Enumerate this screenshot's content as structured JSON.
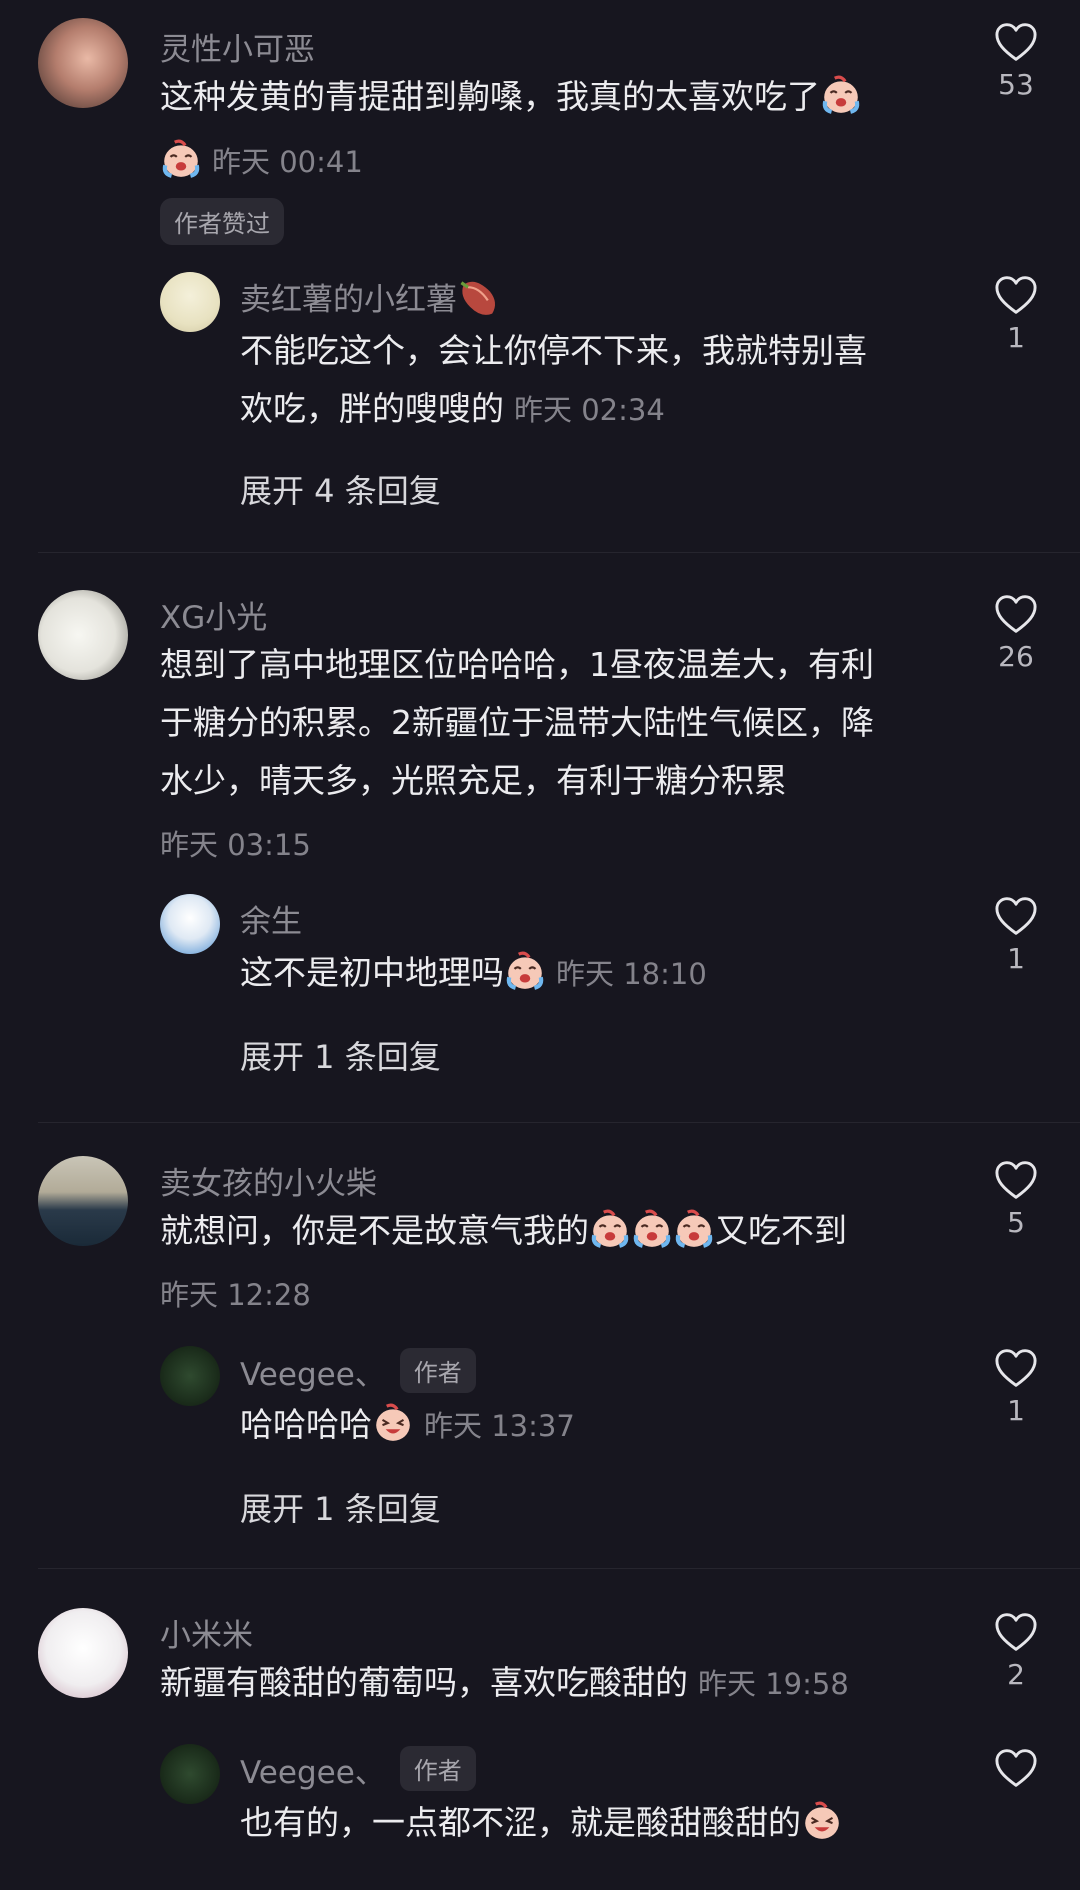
{
  "comments": [
    {
      "username": "灵性小可恶",
      "text_lines": [
        "这种发黄的青提甜到齁嗓，我真的太喜欢吃了"
      ],
      "time": "昨天 00:41",
      "likes": "53",
      "badge": "作者赞过",
      "reply": {
        "username": "卖红薯的小红薯",
        "text_lines": [
          "不能吃这个，会让你停不下来，我就特别喜",
          "欢吃，胖的嗖嗖的"
        ],
        "time": "昨天 02:34",
        "likes": "1"
      },
      "expand": "展开 4 条回复"
    },
    {
      "username": "XG小光",
      "text_lines": [
        "想到了高中地理区位哈哈哈，1昼夜温差大，有利",
        "于糖分的积累。2新疆位于温带大陆性气候区，降",
        "水少，晴天多，光照充足，有利于糖分积累"
      ],
      "time": "昨天 03:15",
      "likes": "26",
      "reply": {
        "username": "余生",
        "text_lines": [
          "这不是初中地理吗"
        ],
        "time": "昨天 18:10",
        "likes": "1"
      },
      "expand": "展开 1 条回复"
    },
    {
      "username": "卖女孩的小火柴",
      "text_lines": [
        "就想问，你是不是故意气我的",
        "又吃不到"
      ],
      "time": "昨天 12:28",
      "likes": "5",
      "reply": {
        "username": "Veegee、",
        "author_badge": "作者",
        "text_lines": [
          "哈哈哈哈"
        ],
        "time": "昨天 13:37",
        "likes": "1"
      },
      "expand": "展开 1 条回复"
    },
    {
      "username": "小米米",
      "text_lines": [
        "新疆有酸甜的葡萄吗，喜欢吃酸甜的"
      ],
      "time": "昨天 19:58",
      "likes": "2",
      "reply": {
        "username": "Veegee、",
        "author_badge": "作者",
        "text_lines": [
          "也有的，一点都不涩，就是酸甜酸甜的"
        ],
        "time": "",
        "likes": ""
      }
    }
  ],
  "icons": {
    "like": "heart-outline-icon",
    "cry_emoji": "crying-face-emoji",
    "sweet_potato_emoji": "sweet-potato-emoji",
    "laugh_emoji": "laughing-face-emoji"
  },
  "colors": {
    "background": "#17161f",
    "text_primary": "#ececef",
    "text_secondary": "#84838b",
    "badge_bg": "#2b2a33"
  }
}
